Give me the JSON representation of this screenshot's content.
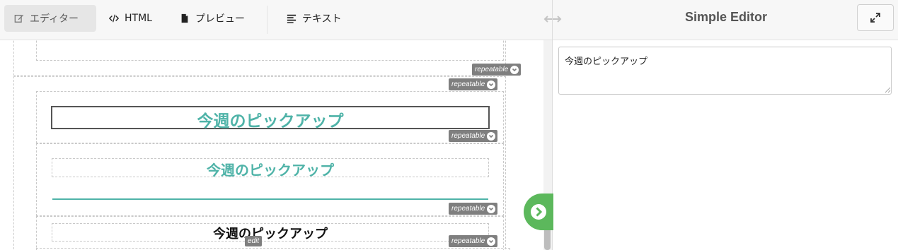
{
  "toolbar": {
    "editor_label": "エディター",
    "html_label": "HTML",
    "preview_label": "プレビュー",
    "text_label": "テキスト"
  },
  "panel": {
    "title": "Simple Editor",
    "textarea_value": "今週のピックアップ"
  },
  "canvas": {
    "repeatable_label": "repeatable",
    "edit_label": "edit",
    "heading_1": "今週のピックアップ",
    "heading_2": "今週のピックアップ",
    "heading_3": "今週のピックアップ"
  },
  "colors": {
    "accent_teal": "#4fb3a8",
    "badge_gray": "#7f7f7f",
    "toggle_green": "#5cb85c"
  },
  "icons": [
    "edit-icon",
    "code-icon",
    "file-icon",
    "align-left-icon",
    "resize-horizontal-icon",
    "expand-icon",
    "chevron-circle-down-icon",
    "chevron-circle-right-icon"
  ]
}
